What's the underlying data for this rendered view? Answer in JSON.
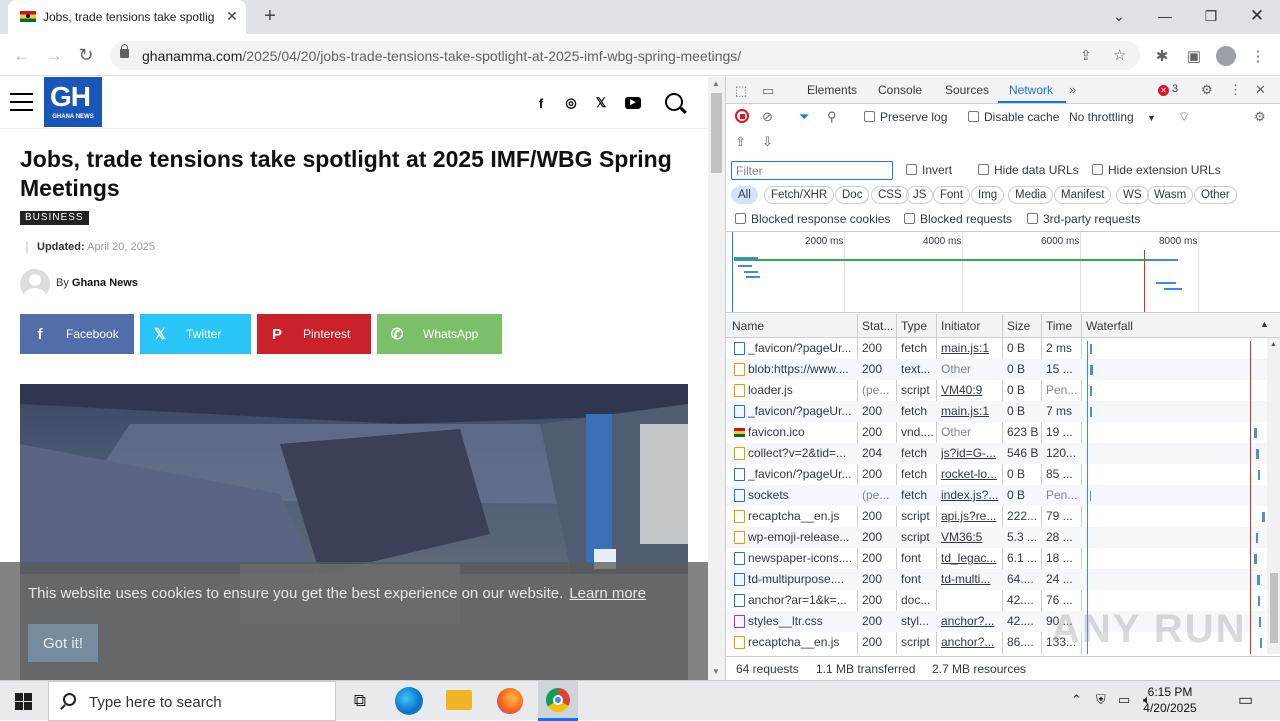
{
  "browser": {
    "tab_title": "Jobs, trade tensions take spotlig",
    "url_domain": "ghanamma.com",
    "url_path": "/2025/04/20/jobs-trade-tensions-take-spotlight-at-2025-imf-wbg-spring-meetings/"
  },
  "site": {
    "logo_text": "GH",
    "logo_sub": "GHANA NEWS",
    "headline": "Jobs, trade tensions take spotlight at 2025 IMF/WBG Spring Meetings",
    "category": "BUSINESS",
    "updated_label": "Updated:",
    "updated_date": "April 20, 2025",
    "by_label": "By",
    "author": "Ghana News",
    "share": [
      {
        "label": "Facebook",
        "icon": "f",
        "color": "#516eab"
      },
      {
        "label": "Twitter",
        "icon": "𝕏",
        "color": "#29c5f6"
      },
      {
        "label": "Pinterest",
        "icon": "P",
        "color": "#ca212a"
      },
      {
        "label": "WhatsApp",
        "icon": "✆",
        "color": "#7bbf6a"
      }
    ],
    "cookie_text": "This website uses cookies to ensure you get the best experience on our website.",
    "cookie_link": "Learn more",
    "cookie_button": "Got it!"
  },
  "devtools": {
    "tabs": [
      "Elements",
      "Console",
      "Sources",
      "Network"
    ],
    "active_tab": "Network",
    "error_count": "3",
    "preserve_log": "Preserve log",
    "disable_cache": "Disable cache",
    "throttling": "No throttling",
    "filter_placeholder": "Filter",
    "invert": "Invert",
    "hide_data_urls": "Hide data URLs",
    "hide_extension_urls": "Hide extension URLs",
    "type_filters": [
      "All",
      "Fetch/XHR",
      "Doc",
      "CSS",
      "JS",
      "Font",
      "Img",
      "Media",
      "Manifest",
      "WS",
      "Wasm",
      "Other"
    ],
    "blocked_cookies": "Blocked response cookies",
    "blocked_requests": "Blocked requests",
    "third_party": "3rd-party requests",
    "overview_ticks": [
      "2000 ms",
      "4000 ms",
      "6000 ms",
      "8000 ms"
    ],
    "columns": [
      "Name",
      "Stat...",
      "Type",
      "Initiator",
      "Size",
      "Time",
      "Waterfall"
    ],
    "rows": [
      {
        "name": "_favicon/?pageUr...",
        "status": "200",
        "type": "fetch",
        "initiator": "main.js:1",
        "size": "0 B",
        "time": "2 ms",
        "icon": "doc"
      },
      {
        "name": "blob:https://www....",
        "status": "200",
        "type": "text...",
        "initiator": "Other",
        "size": "0 B",
        "time": "15 ...",
        "icon": "script"
      },
      {
        "name": "loader.js",
        "status": "(pe...",
        "type": "script",
        "initiator": "VM40:9",
        "size": "0 B",
        "time": "Pen...",
        "icon": "script"
      },
      {
        "name": "_favicon/?pageUr...",
        "status": "200",
        "type": "fetch",
        "initiator": "main.js:1",
        "size": "0 B",
        "time": "7 ms",
        "icon": "doc"
      },
      {
        "name": "favicon.ico",
        "status": "200",
        "type": "vnd....",
        "initiator": "Other",
        "size": "623 B",
        "time": "19 ...",
        "icon": "fav"
      },
      {
        "name": "collect?v=2&tid=...",
        "status": "204",
        "type": "fetch",
        "initiator": "js?id=G-...",
        "size": "546 B",
        "time": "120...",
        "icon": "script"
      },
      {
        "name": "_favicon/?pageUr...",
        "status": "200",
        "type": "fetch",
        "initiator": "rocket-lo...",
        "size": "0 B",
        "time": "85 ...",
        "icon": "doc"
      },
      {
        "name": "sockets",
        "status": "(pe...",
        "type": "fetch",
        "initiator": "index.js?...",
        "size": "0 B",
        "time": "Pen...",
        "icon": "doc"
      },
      {
        "name": "recaptcha__en.js",
        "status": "200",
        "type": "script",
        "initiator": "api.js?re...",
        "size": "222...",
        "time": "79 ...",
        "icon": "script"
      },
      {
        "name": "wp-emoji-release...",
        "status": "200",
        "type": "script",
        "initiator": "VM36:5",
        "size": "5.3 ...",
        "time": "28 ...",
        "icon": "script"
      },
      {
        "name": "newspaper-icons....",
        "status": "200",
        "type": "font",
        "initiator": "td_legac...",
        "size": "6.1 ...",
        "time": "18 ...",
        "icon": "font"
      },
      {
        "name": "td-multipurpose....",
        "status": "200",
        "type": "font",
        "initiator": "td-multi...",
        "size": "64....",
        "time": "24 ...",
        "icon": "font"
      },
      {
        "name": "anchor?ar=1&k=...",
        "status": "200",
        "type": "doc...",
        "initiator": "",
        "size": "42....",
        "time": "76 ...",
        "icon": "doc"
      },
      {
        "name": "styles__ltr.css",
        "status": "200",
        "type": "styl...",
        "initiator": "anchor?...",
        "size": "42....",
        "time": "90 ...",
        "icon": "css"
      },
      {
        "name": "recaptcha__en.js",
        "status": "200",
        "type": "script",
        "initiator": "anchor?...",
        "size": "86....",
        "time": "133...",
        "icon": "script"
      }
    ],
    "footer_requests": "64 requests",
    "footer_transferred": "1.1 MB transferred",
    "footer_resources": "2.7 MB resources"
  },
  "taskbar": {
    "search_placeholder": "Type here to search",
    "time": "6:15 PM",
    "date": "4/20/2025"
  },
  "watermark": "ANY RUN"
}
